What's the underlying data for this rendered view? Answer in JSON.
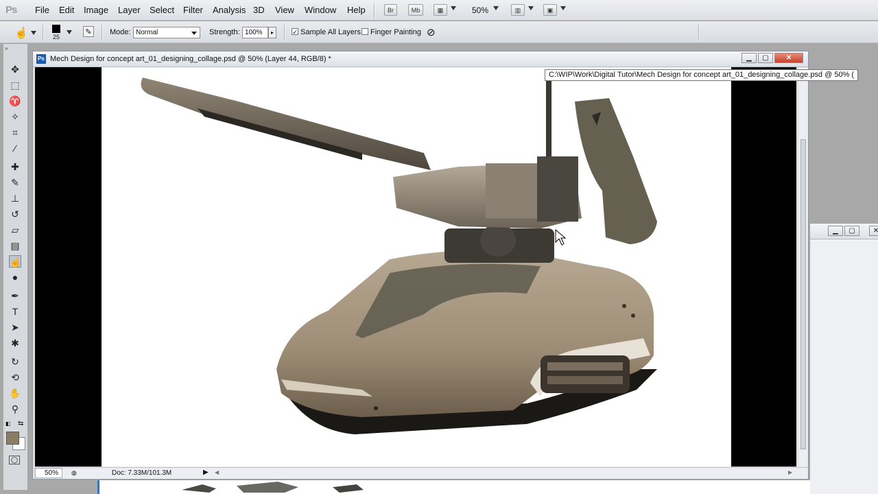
{
  "app": {
    "logo": "Ps"
  },
  "menu": {
    "items": [
      "File",
      "Edit",
      "Image",
      "Layer",
      "Select",
      "Filter",
      "Analysis",
      "3D",
      "View",
      "Window",
      "Help"
    ],
    "bridge_label": "Br",
    "minibridge_label": "Mb",
    "zoom": "50%"
  },
  "options": {
    "brush_size": "25",
    "mode_label": "Mode:",
    "mode_value": "Normal",
    "strength_label": "Strength:",
    "strength_value": "100%",
    "sample_all_layers_label": "Sample All Layers",
    "sample_all_layers_checked": true,
    "finger_painting_label": "Finger Painting",
    "finger_painting_checked": false
  },
  "document": {
    "title": "Mech Design for concept art_01_designing_collage.psd @ 50% (Layer 44, RGB/8) *",
    "tooltip": "C:\\WIP\\Work\\Digital Tutor\\Mech Design for concept art_01_designing_collage.psd @ 50% (",
    "zoom": "50%",
    "doc_info": "Doc: 7.33M/101.3M"
  },
  "colors": {
    "foreground": "#000000",
    "swatch_foreground": "#8a7c65",
    "swatch_background": "#ffffff",
    "accent": "#1f5aa6",
    "close": "#c2452d"
  },
  "icons": {
    "tools": [
      "move-icon",
      "marquee-icon",
      "lasso-icon",
      "quick-select-icon",
      "crop-icon",
      "eyedropper-icon",
      "healing-brush-icon",
      "brush-icon",
      "clone-stamp-icon",
      "history-brush-icon",
      "eraser-icon",
      "gradient-icon",
      "smudge-icon",
      "dodge-icon",
      "pen-icon",
      "type-icon",
      "path-select-icon",
      "shape-icon",
      "3d-rotate-icon",
      "3d-orbit-icon",
      "hand-icon",
      "zoom-icon"
    ]
  }
}
